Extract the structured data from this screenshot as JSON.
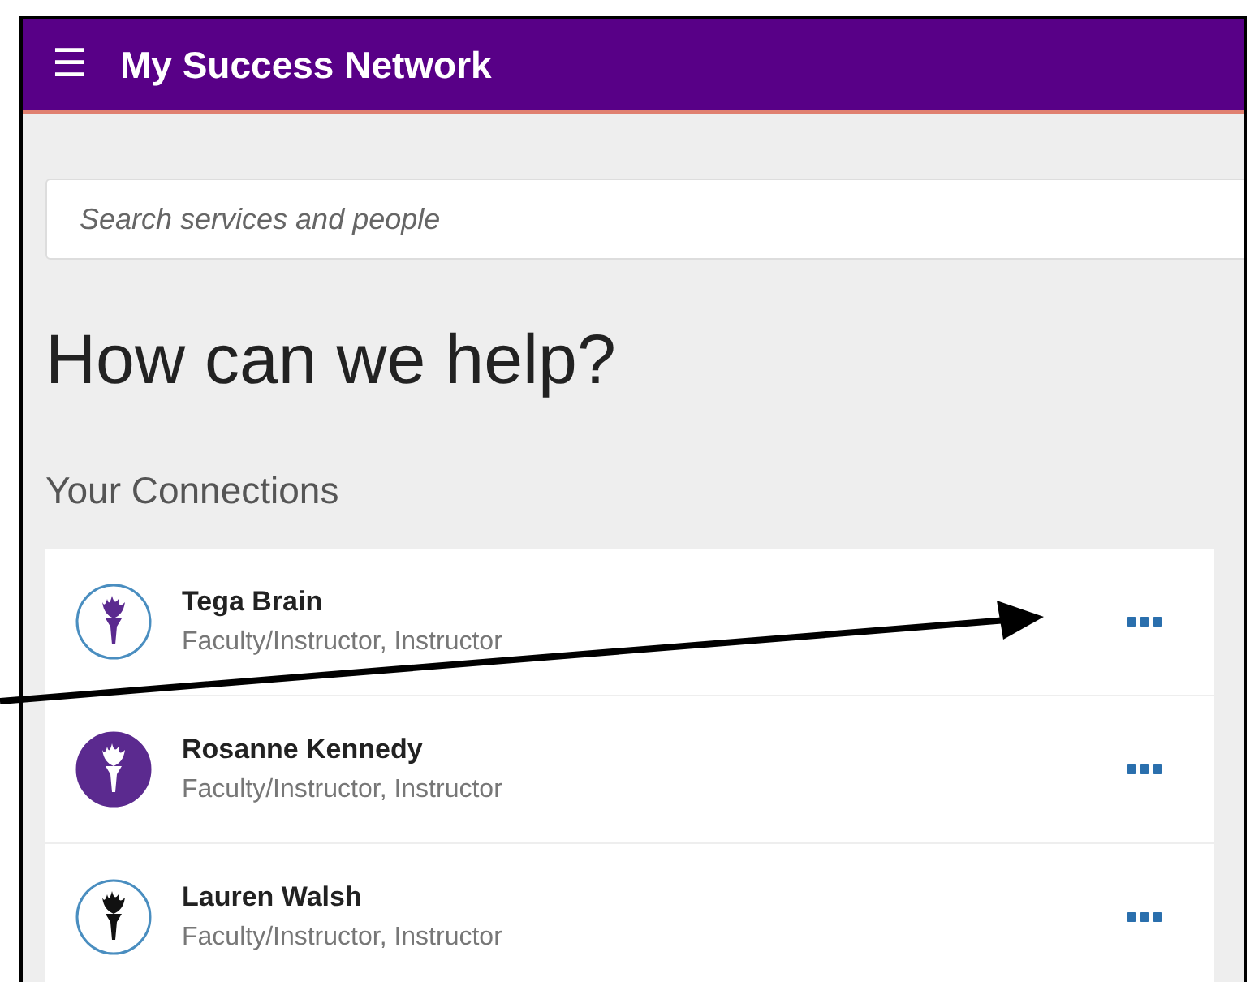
{
  "header": {
    "menu_icon": "☰",
    "title": "My Success Network"
  },
  "search": {
    "placeholder": "Search services and people"
  },
  "heading": "How can we help?",
  "section_title": "Your Connections",
  "connections": [
    {
      "name": "Tega Brain",
      "role": "Faculty/Instructor, Instructor",
      "avatar": {
        "kind": "ring",
        "color": "#5b2a8f"
      }
    },
    {
      "name": "Rosanne Kennedy",
      "role": "Faculty/Instructor, Instructor",
      "avatar": {
        "kind": "filled",
        "color": "#5b2a8f"
      }
    },
    {
      "name": "Lauren Walsh",
      "role": "Faculty/Instructor, Instructor",
      "avatar": {
        "kind": "ring",
        "color": "#111111"
      }
    }
  ]
}
